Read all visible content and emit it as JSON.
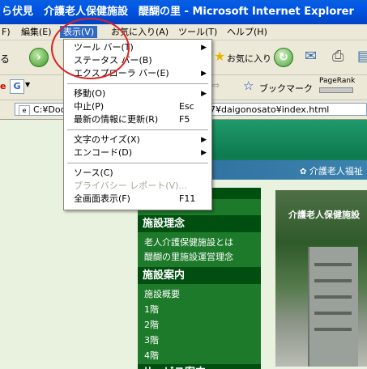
{
  "window": {
    "title": "ら伏見　介護老人保健施設　醍醐の里 - Microsoft Internet Explorer"
  },
  "menubar": {
    "items": [
      {
        "label": "F)"
      },
      {
        "label": "編集(E)"
      },
      {
        "label": "表示(V)"
      },
      {
        "label": "お気に入り(A)"
      },
      {
        "label": "ツール(T)"
      },
      {
        "label": "ヘルプ(H)"
      }
    ]
  },
  "toolbar": {
    "back_label": "る",
    "favorites_label": "お気に入り",
    "search_engine": "G",
    "bookmarks_label": "ブックマーク",
    "pagerank_label": "PageRank"
  },
  "address": {
    "prefix": "C:¥Docu",
    "suffix": "7¥daigonosato¥index.html"
  },
  "dropdown": {
    "items": [
      {
        "label": "ツール バー(T)",
        "shortcut": "",
        "submenu": true
      },
      {
        "label": "ステータス バー(B)",
        "shortcut": "",
        "submenu": false
      },
      {
        "label": "エクスプローラ バー(E)",
        "shortcut": "",
        "submenu": true
      },
      {
        "label": "移動(O)",
        "shortcut": "",
        "submenu": true
      },
      {
        "label": "中止(P)",
        "shortcut": "Esc",
        "submenu": false
      },
      {
        "label": "最新の情報に更新(R)",
        "shortcut": "F5",
        "submenu": false
      },
      {
        "label": "文字のサイズ(X)",
        "shortcut": "",
        "submenu": true
      },
      {
        "label": "エンコード(D)",
        "shortcut": "",
        "submenu": true
      },
      {
        "label": "ソース(C)",
        "shortcut": "",
        "submenu": false
      },
      {
        "label": "プライバシー レポート(V)...",
        "shortcut": "",
        "submenu": false
      },
      {
        "label": "全画面表示(F)",
        "shortcut": "F11",
        "submenu": false
      }
    ]
  },
  "page": {
    "banner_text": "介護老人福祉",
    "photo_caption": "介護老人保健施設",
    "nav": {
      "section1_title": "施設理念",
      "section1_links": [
        "老人介護保健施設とは",
        "醍醐の里施設運営理念"
      ],
      "section2_title": "施設案内",
      "section2_links": [
        "施設概要",
        "1階",
        "2階",
        "3階",
        "4階"
      ],
      "section3_title": "サービス案内"
    }
  },
  "colors": {
    "highlight": "#316ac5",
    "annotation_circle": "#e02020",
    "nav_bg": "#1d7a2a"
  }
}
